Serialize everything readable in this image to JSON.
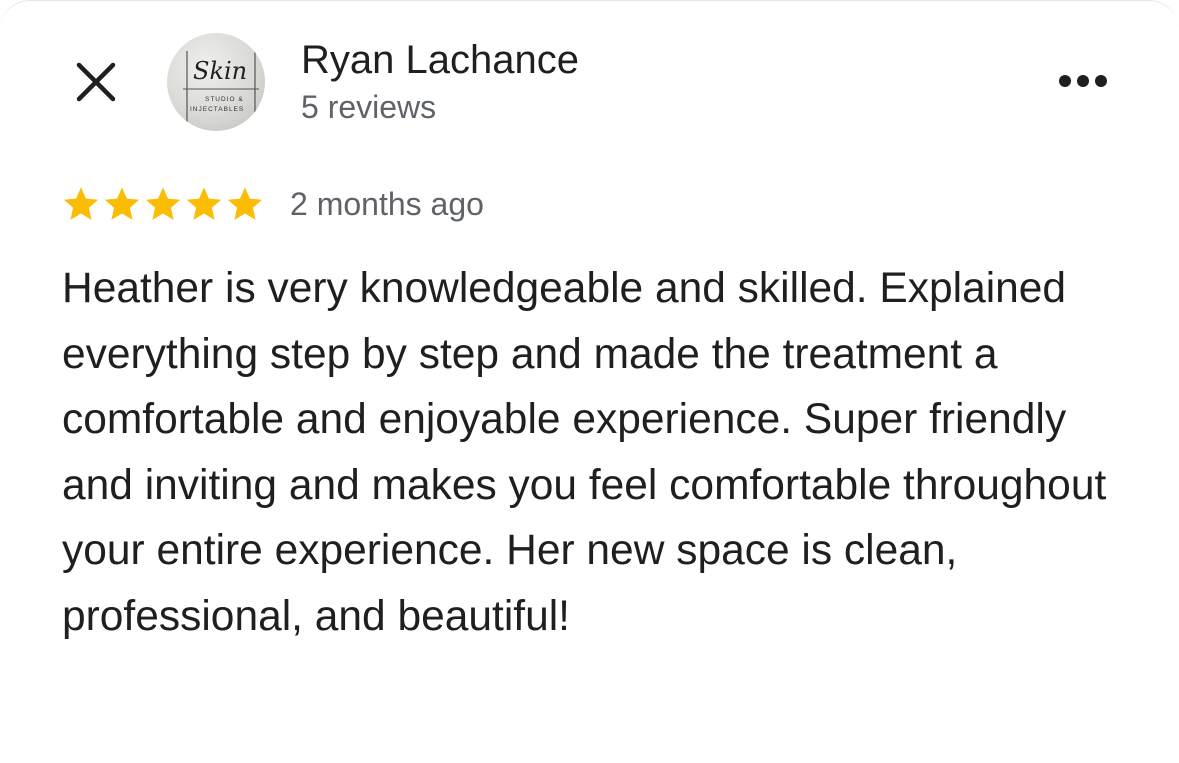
{
  "header": {
    "close_icon": "close-icon",
    "more_icon": "more-horizontal-icon"
  },
  "reviewer": {
    "name": "Ryan Lachance",
    "review_count": "5 reviews",
    "avatar_logo": {
      "script_text": "Skin",
      "line1": "STUDIO &",
      "line2": "INJECTABLES"
    }
  },
  "review": {
    "rating": 5,
    "max_rating": 5,
    "star_color": "#fbbc04",
    "date": "2 months ago",
    "text": "Heather is very knowledgeable and skilled. Explained everything step by step and made the treatment a comfortable and enjoyable experience. Super friendly and inviting and makes you feel comfortable throughout your entire experience. Her new space is clean, professional, and beautiful!"
  }
}
